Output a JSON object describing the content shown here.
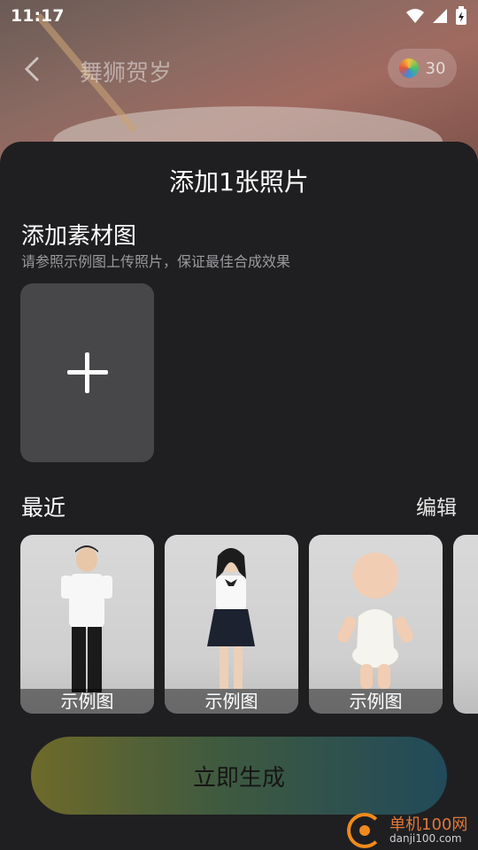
{
  "status_bar": {
    "time": "11:17"
  },
  "nav": {
    "title": "舞狮贺岁",
    "coin_count": "30"
  },
  "sheet": {
    "title": "添加1张照片",
    "section_title": "添加素材图",
    "section_hint": "请参照示例图上传照片，保证最佳合成效果"
  },
  "recent": {
    "label": "最近",
    "edit_label": "编辑",
    "items": [
      {
        "caption": "示例图",
        "subject": "young man in white t-shirt and black pants"
      },
      {
        "caption": "示例图",
        "subject": "young woman in white shirt and dark skirt"
      },
      {
        "caption": "示例图",
        "subject": "baby in white outfit"
      }
    ]
  },
  "actions": {
    "generate_label": "立即生成"
  },
  "watermark": {
    "cn": "单机100网",
    "en": "danji100.com"
  }
}
